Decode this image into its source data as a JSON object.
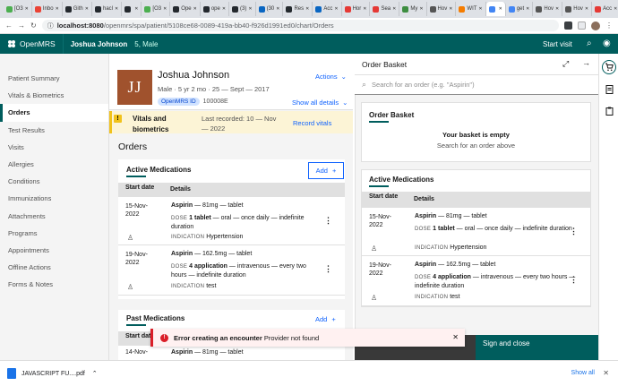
{
  "browser": {
    "tabs": [
      {
        "label": "[O3",
        "color": "#4caf50"
      },
      {
        "label": "Inbo",
        "color": "#ea4335"
      },
      {
        "label": "Gith",
        "color": "#24292e"
      },
      {
        "label": "hacl",
        "color": "#24292e"
      },
      {
        "label": "",
        "color": "#24292e"
      },
      {
        "label": "[O3",
        "color": "#4caf50"
      },
      {
        "label": "Ope",
        "color": "#24292e"
      },
      {
        "label": "ope",
        "color": "#24292e"
      },
      {
        "label": "(3)",
        "color": "#24292e"
      },
      {
        "label": "(30",
        "color": "#0a66c2"
      },
      {
        "label": "Res",
        "color": "#24292e"
      },
      {
        "label": "Acc",
        "color": "#0a66c2"
      },
      {
        "label": "Hor",
        "color": "#e53935"
      },
      {
        "label": "Sea",
        "color": "#e53935"
      },
      {
        "label": "My",
        "color": "#3e8e41"
      },
      {
        "label": "Hov",
        "color": "#555"
      },
      {
        "label": "WIT",
        "color": "#f57c00"
      },
      {
        "label": "",
        "color": "#4285f4"
      },
      {
        "label": "get",
        "color": "#4285f4"
      },
      {
        "label": "Hov",
        "color": "#555"
      },
      {
        "label": "Hov",
        "color": "#555"
      },
      {
        "label": "Acc",
        "color": "#e53935"
      }
    ],
    "url_host": "localhost:8080",
    "url_path": "/openmrs/spa/patient/5108ce68-0089-419a-bb40-f926d1991ed0/chart/Orders"
  },
  "header": {
    "app_name": "OpenMRS",
    "patient_name": "Joshua Johnson",
    "patient_info": "5, Male",
    "start_visit": "Start visit"
  },
  "nav": {
    "items": [
      "Patient Summary",
      "Vitals & Biometrics",
      "Orders",
      "Test Results",
      "Visits",
      "Allergies",
      "Conditions",
      "Immunizations",
      "Attachments",
      "Programs",
      "Appointments",
      "Offline Actions",
      "Forms & Notes"
    ],
    "active_index": 2
  },
  "patient": {
    "initials": "JJ",
    "name": "Joshua Johnson",
    "info": "Male · 5 yr 2 mo · 25 — Sept — 2017",
    "id_label": "OpenMRS ID",
    "id_value": "100008E",
    "actions": "Actions",
    "show_all": "Show all details"
  },
  "vitals": {
    "title": "Vitals and biometrics",
    "recorded": "Last recorded: 10 — Nov — 2022",
    "link": "Record vitals"
  },
  "orders": {
    "heading": "Orders",
    "active_title": "Active Medications",
    "past_title": "Past Medications",
    "add_label": "Add",
    "col_start": "Start date",
    "col_details": "Details",
    "active_rows": [
      {
        "date": "15-Nov-2022",
        "drug": "Aspirin",
        "drug_rest": " — 81mg — tablet",
        "dose_key": "DOSE",
        "dose_bold": "1 tablet",
        "dose_rest": " — oral — once daily — indefinite duration",
        "ind_key": "INDICATION",
        "ind_val": "Hypertension"
      },
      {
        "date": "19-Nov-2022",
        "drug": "Aspirin",
        "drug_rest": " — 162.5mg — tablet",
        "dose_key": "DOSE",
        "dose_bold": "4 application",
        "dose_rest": " — intravenous — every two hours — indefinite duration",
        "ind_key": "INDICATION",
        "ind_val": "test"
      }
    ],
    "past_rows": [
      {
        "date": "14-Nov-",
        "drug": "Aspirin",
        "drug_rest": " — 81mg — tablet"
      }
    ]
  },
  "basket": {
    "title": "Order Basket",
    "search_placeholder": "Search for an order (e.g. \"Aspirin\")",
    "section_title": "Order Basket",
    "empty_title": "Your basket is empty",
    "empty_sub": "Search for an order above",
    "active_title": "Active Medications",
    "sign_close": "Sign and close"
  },
  "toast": {
    "title": "Error creating an encounter",
    "message": "Provider not found"
  },
  "download": {
    "filename": "JAVASCRIPT FU....pdf",
    "show_all": "Show all"
  },
  "colors": {
    "brand": "#005d5d",
    "link": "#0f62fe",
    "error": "#da1e28",
    "warning": "#f1c21b"
  }
}
